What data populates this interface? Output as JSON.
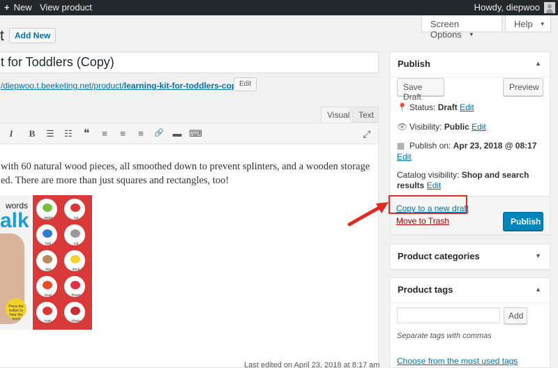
{
  "adminbar": {
    "new_label": "New",
    "view_label": "View product",
    "howdy": "Howdy, diepwoo"
  },
  "screen_options": {
    "label": "Screen Options"
  },
  "help": {
    "label": "Help"
  },
  "page": {
    "title_fragment": "t",
    "add_new": "Add New",
    "post_title": "t for Toddlers (Copy)",
    "permalink_base": "/diepwoo.t.beeketing.net/product/",
    "permalink_slug": "learning-kit-for-toddlers-copy/",
    "edit_slug": "Edit"
  },
  "editor": {
    "tab_visual": "Visual",
    "tab_text": "Text",
    "toolbar": {
      "bold": "B",
      "italic": "I",
      "bullets": "☰",
      "numbers": "☷",
      "quote": "❝",
      "align_left": "≡",
      "align_center": "≡",
      "align_right": "≡",
      "link": "🔗",
      "more": "▬",
      "kitchen": "⌨",
      "fullscreen": "⤢"
    },
    "line1": "with 60 natural wood pieces, all smoothed down to prevent splinters, and a wooden storage",
    "line2": "ed. There are more than just squares and rectangles, too!",
    "image": {
      "words": "words",
      "talk": "alk",
      "bubbles": [
        "apple",
        "car",
        "ball",
        "cat",
        "dog",
        "duck",
        "boat",
        "flower",
        "train",
        "shoes"
      ],
      "press": "Press the button to hear the word"
    },
    "last_edited": "Last edited on April 23, 2018 at 8:17 am"
  },
  "publish": {
    "title": "Publish",
    "save_draft": "Save Draft",
    "preview": "Preview",
    "status_label": "Status:",
    "status_value": "Draft",
    "visibility_label": "Visibility:",
    "visibility_value": "Public",
    "publish_on_label": "Publish on:",
    "publish_on_value": "Apr 23, 2018 @ 08:17",
    "catalog_label": "Catalog visibility:",
    "catalog_value_1": "Shop and search",
    "catalog_value_2": "results",
    "edit": "Edit",
    "copy_draft": "Copy to a new draft",
    "trash": "Move to Trash",
    "publish_button": "Publish"
  },
  "categories": {
    "title": "Product categories"
  },
  "tags": {
    "title": "Product tags",
    "add": "Add",
    "hint": "Separate tags with commas",
    "most_used": "Choose from the most used tags"
  },
  "colors": {
    "accent": "#0073aa",
    "primary_button": "#0085ba",
    "highlight": "#e32a20",
    "trash": "#a00000"
  }
}
